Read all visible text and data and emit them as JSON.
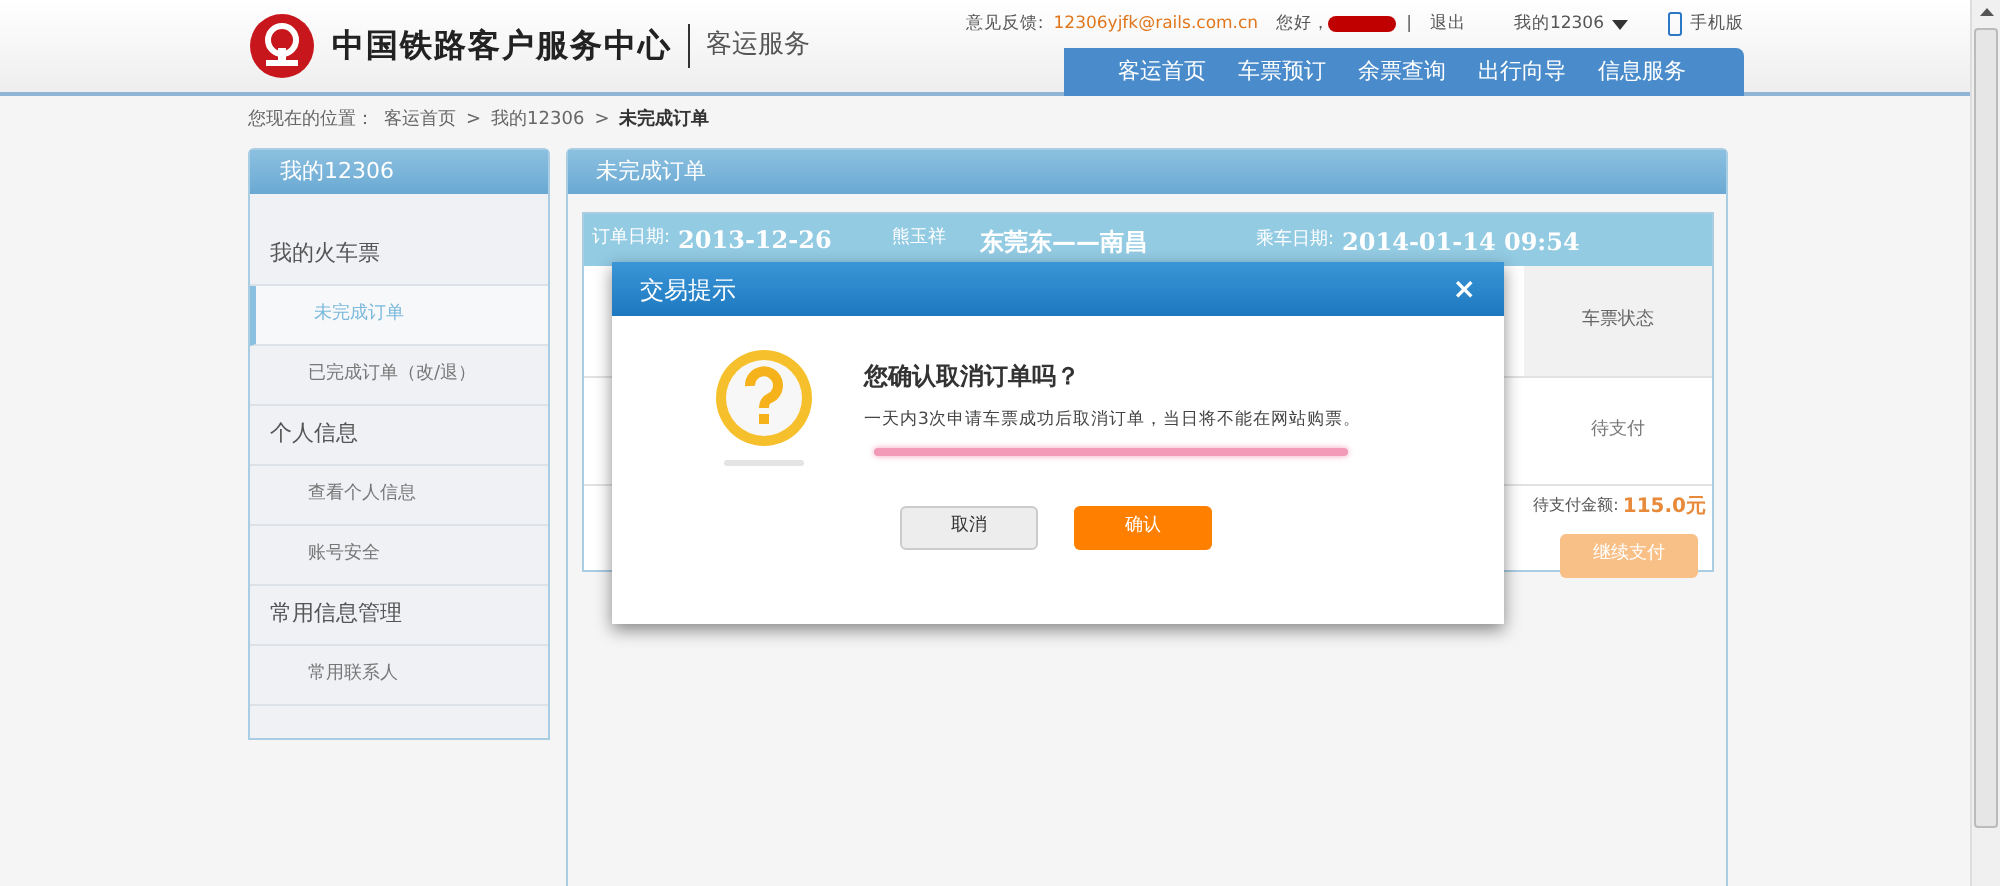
{
  "header": {
    "logo_title": "中国铁路客户服务中心",
    "logo_subtitle": "客运服务",
    "feedback_label": "意见反馈:",
    "feedback_email": "12306yjfk@rails.com.cn",
    "greeting": "您好，",
    "separator": "|",
    "logout": "退出",
    "account_menu": "我的12306",
    "mobile": "手机版"
  },
  "nav": [
    {
      "label": "客运首页",
      "selected": false
    },
    {
      "label": "车票预订",
      "selected": false
    },
    {
      "label": "余票查询",
      "selected": false
    },
    {
      "label": "出行向导",
      "selected": false
    },
    {
      "label": "信息服务",
      "selected": false
    }
  ],
  "breadcrumb": {
    "label": "您现在的位置：",
    "items": [
      "客运首页",
      "我的12306",
      "未完成订单"
    ],
    "separator": ">"
  },
  "sidebar": {
    "title": "我的12306",
    "groups": [
      {
        "label": "我的火车票",
        "items": [
          {
            "label": "未完成订单",
            "selected": true
          },
          {
            "label": "已完成订单（改/退）",
            "selected": false
          }
        ]
      },
      {
        "label": "个人信息",
        "items": [
          {
            "label": "查看个人信息",
            "selected": false
          },
          {
            "label": "账号安全",
            "selected": false
          }
        ]
      },
      {
        "label": "常用信息管理",
        "items": [
          {
            "label": "常用联系人",
            "selected": false
          }
        ]
      }
    ]
  },
  "panel": {
    "title": "未完成订单",
    "order": {
      "date_label": "订单日期:",
      "date": "2013-12-26",
      "passenger": "熊玉祥",
      "route": "东莞东——南昌",
      "travel_label": "乘车日期:",
      "travel_date": "2014-01-14 09:54",
      "status_header": "车票状态",
      "status": "待支付",
      "amount_label": "待支付金额:",
      "amount": "115.0元",
      "pay_button": "继续支付"
    }
  },
  "dialog": {
    "title": "交易提示",
    "close": "×",
    "question": "您确认取消订单吗？",
    "message": "一天内3次申请车票成功后取消订单，当日将不能在网站购票。",
    "buttons": [
      {
        "label": "取消",
        "kind": "secondary"
      },
      {
        "label": "确认",
        "kind": "primary"
      }
    ]
  }
}
